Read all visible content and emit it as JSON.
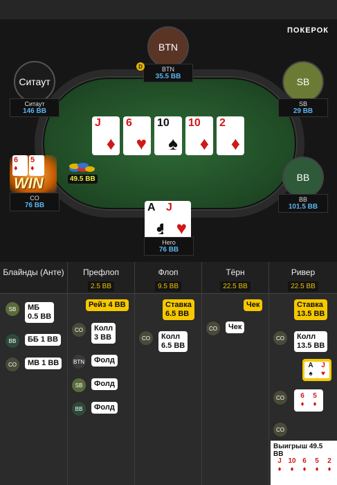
{
  "logo": "ПОКЕРОК",
  "seats": {
    "btn": {
      "avatar": "BTN",
      "name": "BTN",
      "stack": "35.5 BB"
    },
    "sitaut": {
      "avatar": "Ситаут",
      "name": "Ситаут",
      "stack": "146 BB"
    },
    "sb": {
      "avatar": "SB",
      "name": "SB",
      "stack": "29 BB"
    },
    "co": {
      "name": "CO",
      "stack": "76 BB"
    },
    "bb": {
      "avatar": "BB",
      "name": "BB",
      "stack": "101.5 BB"
    },
    "hero": {
      "name": "Hero",
      "stack": "76 BB"
    }
  },
  "dealer_button": "D",
  "board": [
    {
      "rank": "J",
      "suit": "♦",
      "color": "red"
    },
    {
      "rank": "6",
      "suit": "♥",
      "color": "red"
    },
    {
      "rank": "10",
      "suit": "♠",
      "color": "black"
    },
    {
      "rank": "10",
      "suit": "♦",
      "color": "red"
    },
    {
      "rank": "2",
      "suit": "♦",
      "color": "red"
    }
  ],
  "hero_cards": [
    {
      "rank": "A",
      "suit": "♣",
      "color": "black"
    },
    {
      "rank": "J",
      "suit": "♥",
      "color": "red"
    }
  ],
  "co_cards": [
    {
      "rank": "6",
      "suit": "♦"
    },
    {
      "rank": "5",
      "suit": "♦"
    }
  ],
  "win_text": "WIN",
  "pot_chips": "49.5 BB",
  "columns": [
    {
      "name": "Блайнды (Анте)",
      "pot": ""
    },
    {
      "name": "Префлоп",
      "pot": "2.5 BB"
    },
    {
      "name": "Флоп",
      "pot": "9.5 BB"
    },
    {
      "name": "Тёрн",
      "pot": "22.5 BB"
    },
    {
      "name": "Ривер",
      "pot": "22.5 BB"
    }
  ],
  "history": {
    "blinds": [
      {
        "pos": "SB",
        "text": "МБ\n0.5 BB"
      },
      {
        "pos": "BB",
        "text": "ББ 1 BB"
      },
      {
        "pos": "CO",
        "text": "МВ 1 BB"
      }
    ],
    "preflop_raise": "Рейз 4 BB",
    "preflop": [
      {
        "pos": "CO",
        "text": "Колл\n3 BB"
      },
      {
        "pos": "BTN",
        "text": "Фолд"
      },
      {
        "pos": "SB",
        "text": "Фолд"
      },
      {
        "pos": "BB",
        "text": "Фолд"
      }
    ],
    "flop_bet": "Ставка\n6.5 BB",
    "flop": [
      {
        "pos": "CO",
        "text": "Колл\n6.5 BB"
      }
    ],
    "turn_check": "Чек",
    "turn": [
      {
        "pos": "CO",
        "text": "Чек"
      }
    ],
    "river_bet": "Ставка\n13.5 BB",
    "river": [
      {
        "pos": "CO",
        "text": "Колл\n13.5 BB"
      }
    ],
    "river_showdown_hero": [
      {
        "rank": "A",
        "suit": "♠",
        "color": "black"
      },
      {
        "rank": "J",
        "suit": "♥",
        "color": "red"
      }
    ],
    "river_showdown_co": [
      {
        "rank": "6",
        "suit": "♦",
        "color": "red"
      },
      {
        "rank": "5",
        "suit": "♦",
        "color": "red"
      }
    ],
    "win_label": "Выигрыш 49.5 BB",
    "win_pos": "CO",
    "win_cards": [
      {
        "rank": "J",
        "suit": "♦",
        "color": "red"
      },
      {
        "rank": "10",
        "suit": "♦",
        "color": "red"
      },
      {
        "rank": "6",
        "suit": "♦",
        "color": "red"
      },
      {
        "rank": "5",
        "suit": "♦",
        "color": "red"
      },
      {
        "rank": "2",
        "suit": "♦",
        "color": "red"
      }
    ]
  }
}
